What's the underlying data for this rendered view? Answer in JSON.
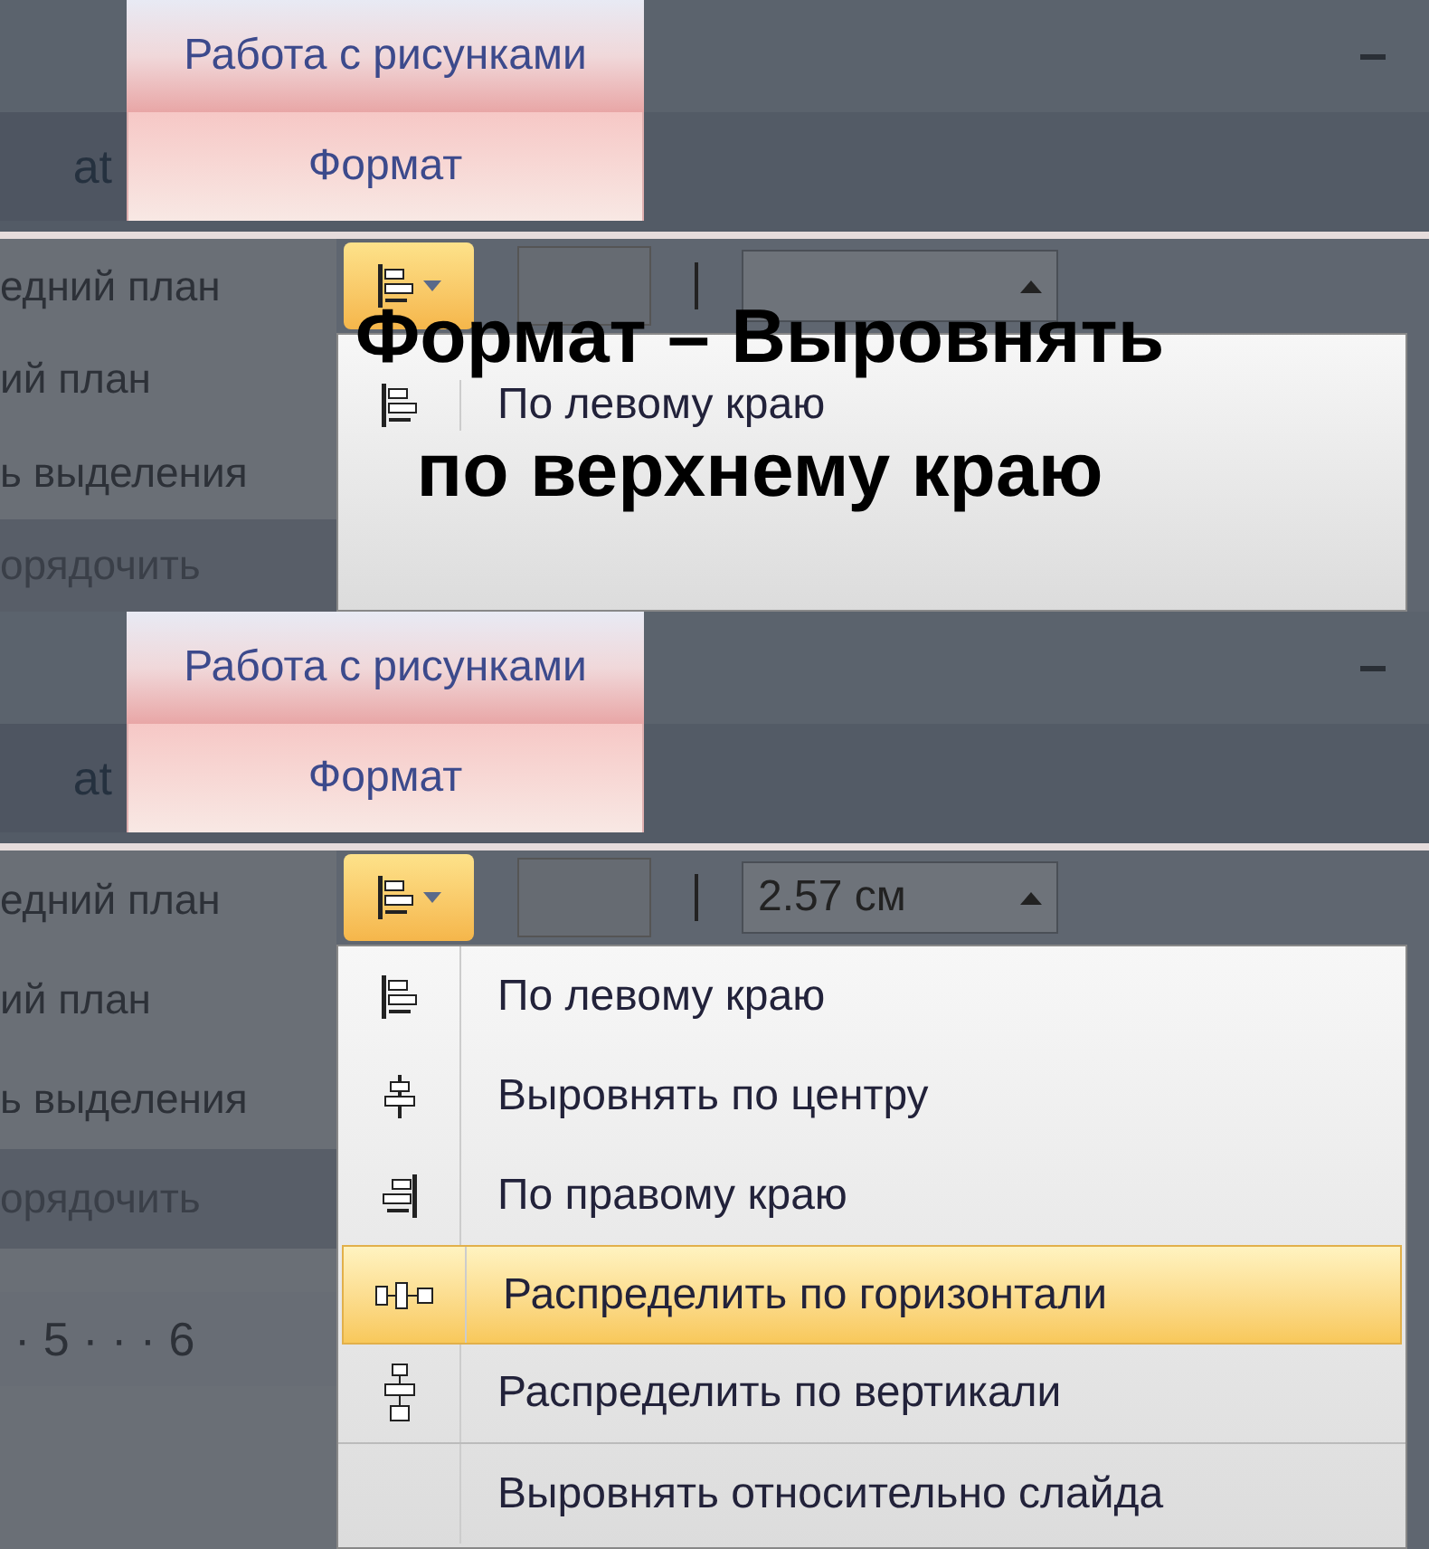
{
  "panels": [
    {
      "context_tab": "Работа с рисунками",
      "tabs": [
        {
          "label": "at",
          "selected": false
        },
        {
          "label": "Формат",
          "selected": true
        }
      ],
      "ribbon_items": [
        "едний план",
        "ий план",
        "ь выделения",
        "орядочить"
      ],
      "menu": [
        {
          "kind": "left",
          "label": "По левому краю",
          "selected": false
        }
      ]
    },
    {
      "context_tab": "Работа с рисунками",
      "tabs": [
        {
          "label": "at",
          "selected": false
        },
        {
          "label": "Формат",
          "selected": true
        }
      ],
      "ribbon_items": [
        "едний план",
        "ий план",
        "ь выделения",
        "орядочить"
      ],
      "size_value": "2.57 см",
      "ruler": "· 5 · · · 6",
      "menu": [
        {
          "kind": "left",
          "label": "По левому краю",
          "selected": false
        },
        {
          "kind": "center",
          "label": "Выровнять по центру",
          "selected": false
        },
        {
          "kind": "right",
          "label": "По правому краю",
          "selected": false
        },
        {
          "kind": "hdist",
          "label": "Распределить по горизонтали",
          "selected": true
        },
        {
          "kind": "vdist",
          "label": "Распределить по вертикали",
          "selected": false
        },
        {
          "kind": "slide",
          "label": "Выровнять относительно слайда",
          "selected": false
        }
      ]
    }
  ],
  "overlay_title": [
    "Формат – Выровнять",
    "по верхнему краю"
  ]
}
